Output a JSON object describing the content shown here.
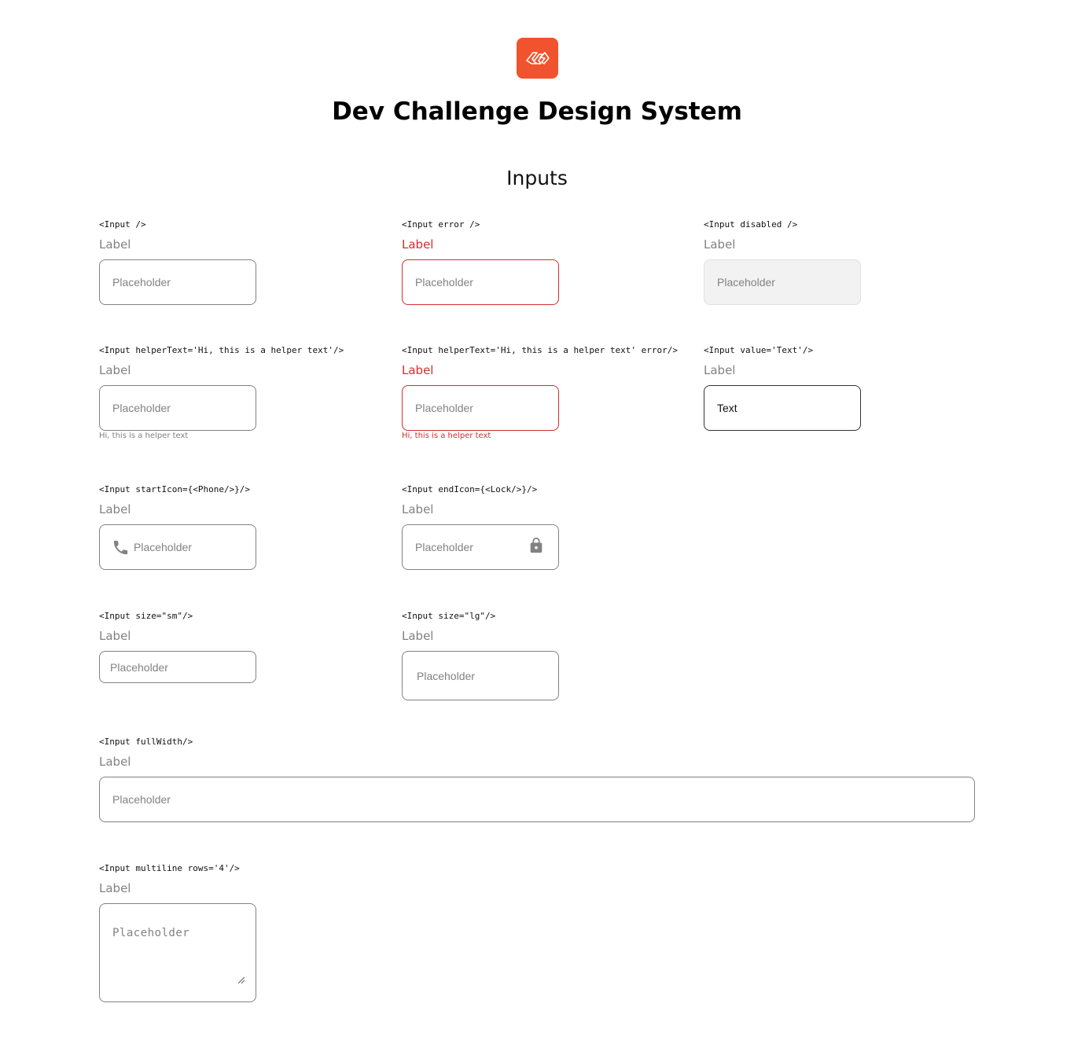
{
  "header": {
    "title": "Dev Challenge Design System",
    "logo_icon": "dev-challenge-logo-icon",
    "logo_color": "#f0532d"
  },
  "section": {
    "title": "Inputs"
  },
  "colors": {
    "label": "#828282",
    "error": "#d32f2f",
    "disabled_bg": "#f2f2f2",
    "border": "#828282"
  },
  "demos": {
    "default": {
      "code": "<Input />",
      "label": "Label",
      "placeholder": "Placeholder"
    },
    "error": {
      "code": "<Input error />",
      "label": "Label",
      "placeholder": "Placeholder"
    },
    "disabled": {
      "code": "<Input disabled />",
      "label": "Label",
      "placeholder": "Placeholder"
    },
    "helper": {
      "code": "<Input helperText='Hi, this is a helper text'/>",
      "label": "Label",
      "placeholder": "Placeholder",
      "helper": "Hi, this is a helper text"
    },
    "helper_error": {
      "code": "<Input helperText='Hi, this is a helper text' error/>",
      "label": "Label",
      "placeholder": "Placeholder",
      "helper": "Hi, this is a helper text"
    },
    "value": {
      "code": "<Input value='Text'/>",
      "label": "Label",
      "value": "Text"
    },
    "start_icon": {
      "code": "<Input startIcon={<Phone/>}/>",
      "label": "Label",
      "placeholder": "Placeholder",
      "icon": "phone-icon"
    },
    "end_icon": {
      "code": "<Input endIcon={<Lock/>}/>",
      "label": "Label",
      "placeholder": "Placeholder",
      "icon": "lock-icon"
    },
    "size_sm": {
      "code": "<Input size=\"sm\"/>",
      "label": "Label",
      "placeholder": "Placeholder"
    },
    "size_lg": {
      "code": "<Input size=\"lg\"/>",
      "label": "Label",
      "placeholder": "Placeholder"
    },
    "full_width": {
      "code": "<Input fullWidth/>",
      "label": "Label",
      "placeholder": "Placeholder"
    },
    "multiline": {
      "code": "<Input multiline rows='4'/>",
      "label": "Label",
      "placeholder": "Placeholder"
    }
  }
}
